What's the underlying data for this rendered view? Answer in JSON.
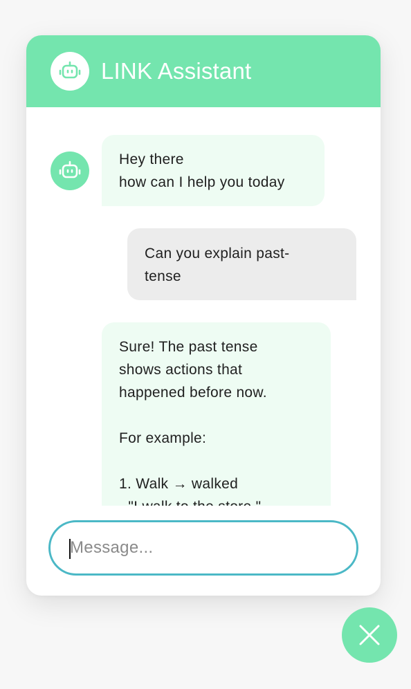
{
  "header": {
    "title": "LINK Assistant",
    "avatar_icon": "robot-icon"
  },
  "messages": [
    {
      "sender": "bot",
      "text": "Hey there\nhow can I help you today"
    },
    {
      "sender": "user",
      "text": "Can you explain past-\ntense"
    },
    {
      "sender": "bot",
      "text": "Sure! The past tense\nshows actions that\nhappened before now.\n\nFor example:\n\n1. Walk → walked\n- \"I walk to the store.\""
    }
  ],
  "composer": {
    "placeholder": "Message...",
    "value": ""
  },
  "close_button": {
    "icon": "close-icon"
  },
  "colors": {
    "accent": "#74e5ae",
    "bot_bubble": "#eefcf3",
    "user_bubble": "#ececec",
    "input_border": "#4bb8c6"
  }
}
